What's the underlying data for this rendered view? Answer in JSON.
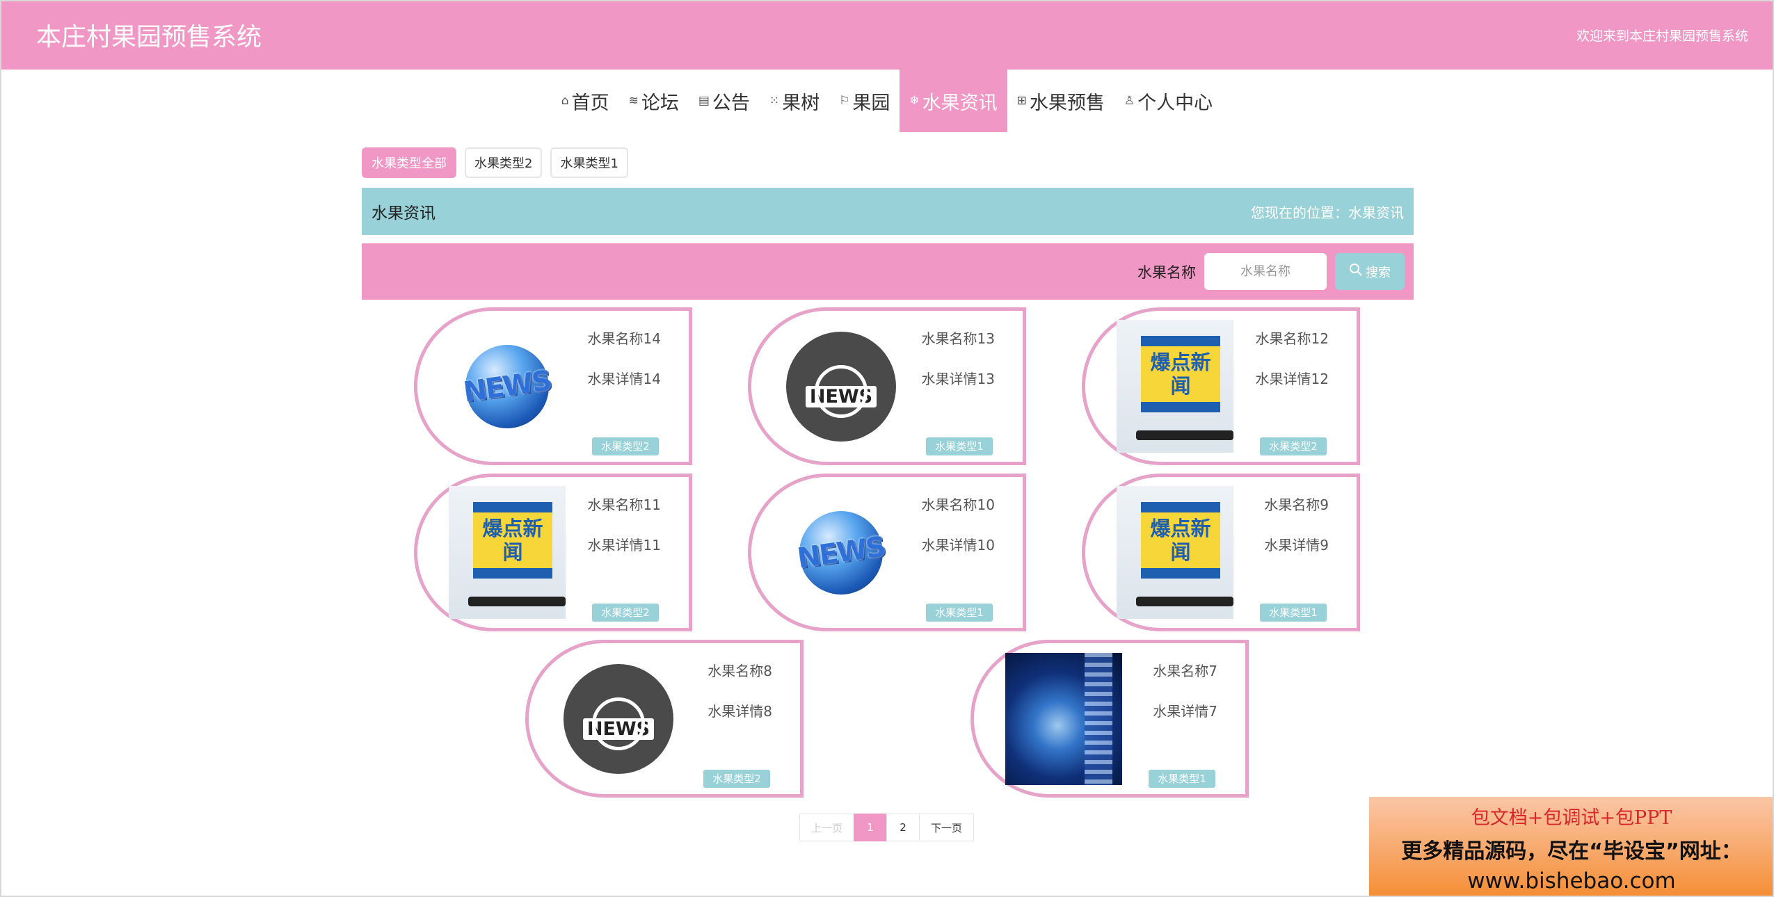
{
  "header": {
    "site_title": "本庄村果园预售系统",
    "welcome": "欢迎来到本庄村果园预售系统"
  },
  "nav": {
    "items": [
      {
        "icon": "home-icon",
        "glyph": "⌂",
        "label": "首页"
      },
      {
        "icon": "layers-icon",
        "glyph": "≋",
        "label": "论坛"
      },
      {
        "icon": "calendar-icon",
        "glyph": "▤",
        "label": "公告"
      },
      {
        "icon": "grid-icon",
        "glyph": "⁙",
        "label": "果树"
      },
      {
        "icon": "flag-icon",
        "glyph": "⚐",
        "label": "果园"
      },
      {
        "icon": "snowflake-icon",
        "glyph": "❄",
        "label": "水果资讯",
        "active": true
      },
      {
        "icon": "apps-icon",
        "glyph": "⊞",
        "label": "水果预售"
      },
      {
        "icon": "user-icon",
        "glyph": "♙",
        "label": "个人中心"
      }
    ]
  },
  "filters": [
    {
      "label": "水果类型全部",
      "active": true
    },
    {
      "label": "水果类型2"
    },
    {
      "label": "水果类型1"
    }
  ],
  "title_bar": {
    "title": "水果资讯",
    "location": "您现在的位置：水果资讯"
  },
  "search": {
    "label": "水果名称",
    "placeholder": "水果名称",
    "button_label": "搜索"
  },
  "cards": [
    {
      "name": "水果名称14",
      "detail": "水果详情14",
      "tag": "水果类型2",
      "image": "globe-news"
    },
    {
      "name": "水果名称13",
      "detail": "水果详情13",
      "tag": "水果类型1",
      "image": "news-circle"
    },
    {
      "name": "水果名称12",
      "detail": "水果详情12",
      "tag": "水果类型2",
      "image": "hot-news"
    },
    {
      "name": "水果名称11",
      "detail": "水果详情11",
      "tag": "水果类型2",
      "image": "hot-news"
    },
    {
      "name": "水果名称10",
      "detail": "水果详情10",
      "tag": "水果类型1",
      "image": "globe-news"
    },
    {
      "name": "水果名称9",
      "detail": "水果详情9",
      "tag": "水果类型1",
      "image": "hot-news"
    },
    {
      "name": "水果名称8",
      "detail": "水果详情8",
      "tag": "水果类型2",
      "image": "news-circle"
    },
    {
      "name": "水果名称7",
      "detail": "水果详情7",
      "tag": "水果类型1",
      "image": "space-globe"
    }
  ],
  "image_text": {
    "globe": "NEWS",
    "news_circle": "NEWS",
    "hot": "爆点新闻"
  },
  "pagination": {
    "prev": "上一页",
    "pages": [
      "1",
      "2"
    ],
    "current": "1",
    "next": "下一页"
  },
  "promo": {
    "line1": "包文档+包调试+包PPT",
    "line2": "更多精品源码，尽在“毕设宝”网址：",
    "line3": "www.bishebao.com"
  },
  "colors": {
    "primary_pink": "#f197c6",
    "accent_teal": "#98d1d8",
    "card_border": "#e6a2c8"
  }
}
